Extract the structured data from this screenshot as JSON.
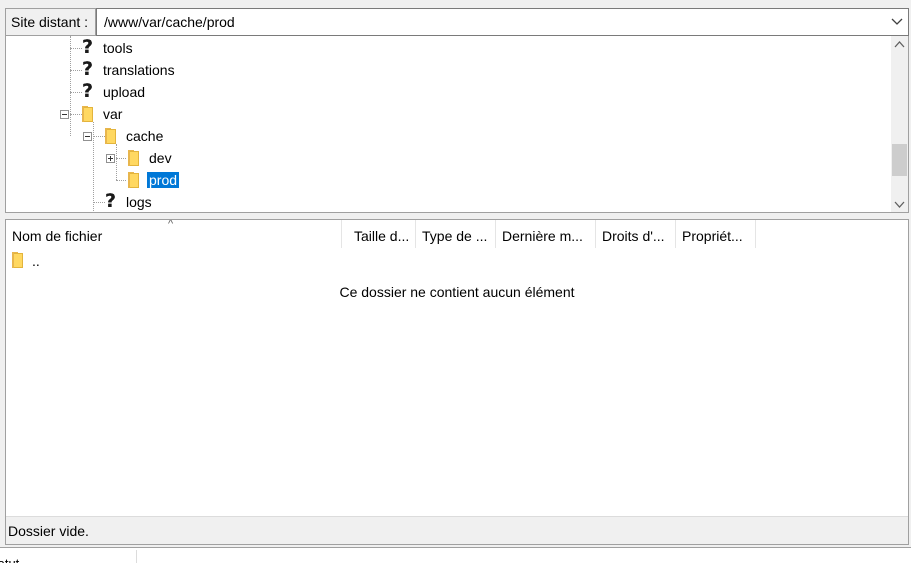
{
  "address_bar": {
    "label": "Site distant :",
    "path": "/www/var/cache/prod",
    "dropdown_icon": "chevron-down-icon"
  },
  "tree": {
    "items": [
      {
        "label": "tools",
        "icon": "question-icon",
        "selected": false
      },
      {
        "label": "translations",
        "icon": "question-icon",
        "selected": false
      },
      {
        "label": "upload",
        "icon": "question-icon",
        "selected": false
      },
      {
        "label": "var",
        "icon": "folder-icon",
        "selected": false,
        "expanded": true
      },
      {
        "label": "cache",
        "icon": "folder-icon",
        "selected": false,
        "expanded": true
      },
      {
        "label": "dev",
        "icon": "folder-icon",
        "selected": false,
        "expanded": false
      },
      {
        "label": "prod",
        "icon": "folder-icon",
        "selected": true
      },
      {
        "label": "logs",
        "icon": "question-icon",
        "selected": false
      }
    ],
    "selection_color": "#0078d7"
  },
  "file_list": {
    "columns": [
      "Nom de fichier",
      "Taille d...",
      "Type de ...",
      "Dernière m...",
      "Droits d'...",
      "Propriét..."
    ],
    "parent_entry": "..",
    "empty_message": "Ce dossier ne contient aucun élément",
    "status": "Dossier vide."
  },
  "bottom_bar": {
    "label": "tatut"
  }
}
